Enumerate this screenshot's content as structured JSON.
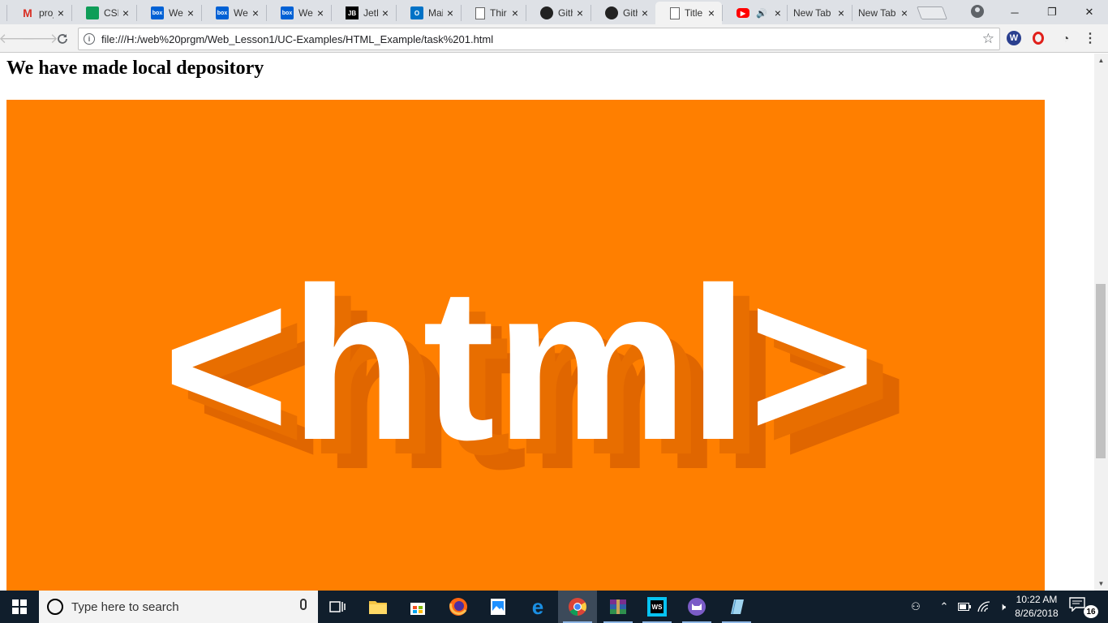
{
  "browser": {
    "tabs": [
      {
        "title": "proj",
        "favicon": "gmail-icon",
        "active": false
      },
      {
        "title": "CSE",
        "favicon": "sheets-icon",
        "active": false
      },
      {
        "title": "Wel",
        "favicon": "box-icon",
        "active": false
      },
      {
        "title": "Wel",
        "favicon": "box-icon",
        "active": false
      },
      {
        "title": "Wel",
        "favicon": "box-icon",
        "active": false
      },
      {
        "title": "JetB",
        "favicon": "jetbrains-icon",
        "active": false
      },
      {
        "title": "Mai",
        "favicon": "outlook-icon",
        "active": false
      },
      {
        "title": "Thir",
        "favicon": "document-icon",
        "active": false
      },
      {
        "title": "Gith",
        "favicon": "github-icon",
        "active": false
      },
      {
        "title": "Gith",
        "favicon": "github-icon",
        "active": false
      },
      {
        "title": "Title",
        "favicon": "document-icon",
        "active": true
      },
      {
        "title": "(",
        "favicon": "youtube-icon",
        "active": false
      },
      {
        "title": "New Tab",
        "favicon": "none",
        "active": false
      },
      {
        "title": "New Tab",
        "favicon": "none",
        "active": false
      }
    ],
    "favicon_glyphs": {
      "box": "box",
      "jetbrains": "JB",
      "outlook": "O",
      "gmail": "M"
    },
    "url": "file:///H:/web%20prgm/Web_Lesson1/UC-Examples/HTML_Example/task%201.html",
    "window_controls": {
      "minimize": "─",
      "restore": "❐",
      "close": "✕"
    },
    "extensions": {
      "w": "W"
    },
    "colors": {
      "tabstrip": "#dee1e6",
      "toolbar": "#f2f2f2"
    }
  },
  "page": {
    "heading": "We have made local depository",
    "banner": {
      "text": "<html>",
      "background": "#ff7f00",
      "shadow": "#e06600",
      "text_color": "#ffffff"
    }
  },
  "taskbar": {
    "search_placeholder": "Type here to search",
    "apps": [
      "task-view-icon",
      "file-explorer-icon",
      "store-icon",
      "firefox-icon",
      "photos-icon",
      "edge-icon",
      "chrome-icon",
      "winrar-icon",
      "webstorm-icon",
      "cat-app-icon",
      "notepad-icon"
    ],
    "webstorm_label": "WS",
    "clock": {
      "time": "10:22 AM",
      "date": "8/26/2018"
    },
    "notification_count": "16",
    "background": "#101e2c"
  }
}
